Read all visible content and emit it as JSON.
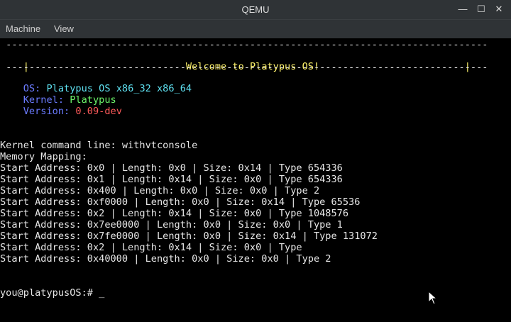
{
  "window": {
    "title": "QEMU",
    "buttons": {
      "minimize": "—",
      "maximize": "☐",
      "close": "✕"
    }
  },
  "menu": [
    "Machine",
    "View"
  ],
  "console": {
    "banner_rule": " -----------------------------------------------------------------------------------",
    "banner_left": "|",
    "banner_text": "Welcome to Platypus OS!",
    "banner_right": "|",
    "banner_rule2": " -----------------------------------------------------------------------------------",
    "os_label": "OS:",
    "os_value": "Platypus OS x86_32 x86_64",
    "kernel_label": "Kernel:",
    "kernel_value": "Platypus",
    "version_label": "Version:",
    "version_value": "0.09-dev",
    "cmdline": "Kernel command line: withvtconsole",
    "mem_header": "Memory Mapping:",
    "mem_lines": [
      "Start Address: 0x0 | Length: 0x0 | Size: 0x14 | Type 654336",
      "Start Address: 0x1 | Length: 0x14 | Size: 0x0 | Type 654336",
      "Start Address: 0x400 | Length: 0x0 | Size: 0x0 | Type 2",
      "Start Address: 0xf0000 | Length: 0x0 | Size: 0x14 | Type 65536",
      "Start Address: 0x2 | Length: 0x14 | Size: 0x0 | Type 1048576",
      "Start Address: 0x7ee0000 | Length: 0x0 | Size: 0x0 | Type 1",
      "Start Address: 0x7fe0000 | Length: 0x0 | Size: 0x14 | Type 131072",
      "Start Address: 0x2 | Length: 0x14 | Size: 0x0 | Type",
      "Start Address: 0x40000 | Length: 0x0 | Size: 0x0 | Type 2"
    ],
    "prompt": "you@platypusOS:# _"
  }
}
